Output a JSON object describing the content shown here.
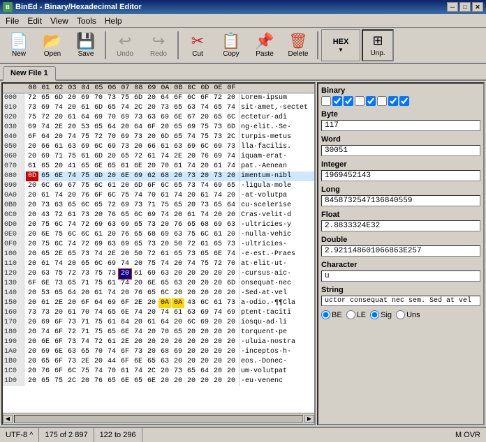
{
  "titleBar": {
    "title": "BinEd - Binary/Hexadecimal Editor",
    "minLabel": "─",
    "maxLabel": "□",
    "closeLabel": "✕"
  },
  "menuBar": {
    "items": [
      "File",
      "Edit",
      "View",
      "Tools",
      "Help"
    ]
  },
  "toolbar": {
    "newLabel": "New",
    "openLabel": "Open",
    "saveLabel": "Save",
    "undoLabel": "Undo",
    "redoLabel": "Redo",
    "cutLabel": "Cut",
    "copyLabel": "Copy",
    "pasteLabel": "Paste",
    "deleteLabel": "Delete",
    "hexLabel": "HEX",
    "unpLabel": "Unp."
  },
  "tab": {
    "label": "New File 1"
  },
  "hexHeader": {
    "cols": [
      "00",
      "01",
      "02",
      "03",
      "04",
      "05",
      "06",
      "07",
      "08",
      "09",
      "0A",
      "0B",
      "0C",
      "0D",
      "0E",
      "0F"
    ]
  },
  "hexRows": [
    {
      "addr": "000",
      "bytes": "72 65 6D 20 69 70 73 75 6D 20 64 6F 6C 6F 72 20",
      "text": "Lorem ipsum",
      "highlight": false
    },
    {
      "addr": "010",
      "bytes": "73 69 74 20 61 6D 65 74 2C 20 73 65 63 74 65 74",
      "text": "sit.amet,.sectet",
      "highlight": false
    },
    {
      "addr": "020",
      "bytes": "75 72 20 61 64 69 70 69 73 63 69 6E 67 20 65 6C",
      "text": "ectetur·adi",
      "highlight": false
    },
    {
      "addr": "030",
      "bytes": "69 74 2E 20 53 65 64 20 64 6F 20 65 69 75 73 6D",
      "text": "ng.elit.·Se·",
      "highlight": false
    },
    {
      "addr": "040",
      "bytes": "6F 64 20 74 75 72 70 69 73 20 6D 65 74 75 73 2C",
      "text": "turpis·metus",
      "highlight": false
    },
    {
      "addr": "050",
      "bytes": "20 66 61 63 69 6C 69 73 20 66 61 63 69 6C 69 73",
      "text": "lla.facilis.",
      "highlight": false
    },
    {
      "addr": "060",
      "bytes": "20 69 71 75 61 6D 20 65 72 61 74 2E 20 76 69 74",
      "text": "iquam·erat·",
      "highlight": false
    },
    {
      "addr": "070",
      "bytes": "61 65 20 41 65 6E 65 61 6E 20 70 61 74 20 61 74",
      "text": "pat.·Aenean",
      "highlight": false
    },
    {
      "addr": "080",
      "bytes": "D 65 6E 74 75 6D 20 6E 69 62 68 20 73 20 73 20",
      "text": "imentum·nibl",
      "highlight": true
    },
    {
      "addr": "090",
      "bytes": "20 6C 69 67 75 6C 61 20 6D 6F 6C 65 73 74 69 65",
      "text": "·ligula·mole",
      "highlight": false
    },
    {
      "addr": "0A0",
      "bytes": "20 61 74 20 76 6F 6C 75 74 70 61 74 20 61 74 20",
      "text": "·at·volutpa",
      "highlight": false
    },
    {
      "addr": "0B0",
      "bytes": "20 73 63 65 6C 65 72 69 73 71 75 65 20 73 65 64",
      "text": "cu·scelerise",
      "highlight": false
    },
    {
      "addr": "0C0",
      "bytes": "20 43 72 61 73 20 76 65 6C 69 74 20 61 74 20 20",
      "text": "Cras·velit·d",
      "highlight": false
    },
    {
      "addr": "0D0",
      "bytes": "20 75 6C 74 72 69 63 69 65 73 20 76 65 68 69 63",
      "text": "·ultricies·y",
      "highlight": false
    },
    {
      "addr": "0E0",
      "bytes": "20 6E 75 6C 6C 61 20 76 65 68 69 63 75 6C 61 20",
      "text": "·nulla·vehic",
      "highlight": false
    },
    {
      "addr": "0F0",
      "bytes": "20 75 6C 74 72 69 63 69 65 73 20 50 72 61 65 73",
      "text": "·ultricies·",
      "highlight": false
    },
    {
      "addr": "100",
      "bytes": "20 65 2E 65 73 74 2E 20 50 72 61 65 73 65 6E 74",
      "text": "·e·est.·Praes",
      "highlight": false
    },
    {
      "addr": "110",
      "bytes": "20 61 74 20 65 6C 69 74 20 75 74 20 74 75 72 70",
      "text": "at·elit·ut·",
      "highlight": false
    },
    {
      "addr": "120",
      "bytes": "20 63 75 72 73 75 73 20 61 69 63 20 20 20 20 20",
      "text": "·cursus·aic·",
      "highlight": false
    },
    {
      "addr": "130",
      "bytes": "6F 6E 73 65 71 75 61 74 20 6E 65 63 20 20 20 6D",
      "text": "onsequat·nec",
      "highlight": false
    },
    {
      "addr": "140",
      "bytes": "20 53 65 64 20 61 74 20 76 65 6C 20 20 20 20 20",
      "text": "·Sed·at·vel",
      "highlight": false
    },
    {
      "addr": "150",
      "bytes": "20 61 2E 20 6F 64 69 6F 2E 20 OA OA 43 6C 61 73",
      "text": "a·odio.·¶¶Cla",
      "highlight": false
    },
    {
      "addr": "160",
      "bytes": "73 73 20 61 70 74 65 6E 74 20 74 61 63 69 74 69",
      "text": "ptent·taciti",
      "highlight": false
    },
    {
      "addr": "170",
      "bytes": "20 69 6F 73 71 75 61 64 20 61 64 20 6C 69 20 20",
      "text": "iosqu·ad·li",
      "highlight": false
    },
    {
      "addr": "180",
      "bytes": "20 74 6F 72 71 75 65 6E 74 20 70 65 20 20 20 20",
      "text": "torquent·pe",
      "highlight": false
    },
    {
      "addr": "190",
      "bytes": "20 6E 6F 73 74 72 61 2E 20 20 20 20 20 20 20 20",
      "text": "·uluia·nostra",
      "highlight": false
    },
    {
      "addr": "1A0",
      "bytes": "20 69 6E 63 65 70 74 6F 73 20 68 69 20 20 20 20",
      "text": "·inceptos·h·",
      "highlight": false
    },
    {
      "addr": "1B0",
      "bytes": "20 65 6F 73 2E 20 44 6F 6E 65 63 20 20 20 20 20",
      "text": "eos.·Donec·",
      "highlight": false
    },
    {
      "addr": "1C0",
      "bytes": "20 76 6F 6C 75 74 70 61 74 2C 20 73 65 64 20 20",
      "text": "um·volutpat",
      "highlight": false
    },
    {
      "addr": "1D0",
      "bytes": "20 65 75 2C 20 76 65 6E 65 6E 20 20 20 20 20 20",
      "text": "·eu·venenc",
      "highlight": false
    }
  ],
  "rightPanel": {
    "binaryLabel": "Binary",
    "byteLabel": "Byte",
    "byteValue": "117",
    "wordLabel": "Word",
    "wordValue": "30051",
    "integerLabel": "Integer",
    "integerValue": "1969452143",
    "longLabel": "Long",
    "longValue": "8458732547136840559",
    "floatLabel": "Float",
    "floatValue": "2.8833324E32",
    "doubleLabel": "Double",
    "doubleValue": "2.921148601066863E257",
    "characterLabel": "Character",
    "characterValue": "u",
    "stringLabel": "String",
    "stringValue": "uctor consequat nec sem. Sed at vel",
    "radioOptions": [
      "BE",
      "LE",
      "Sig",
      "Uns"
    ]
  },
  "statusBar": {
    "encoding": "UTF-8 ^",
    "position": "175 of 2 897",
    "range": "122 to 296",
    "mode": "M OVR"
  }
}
